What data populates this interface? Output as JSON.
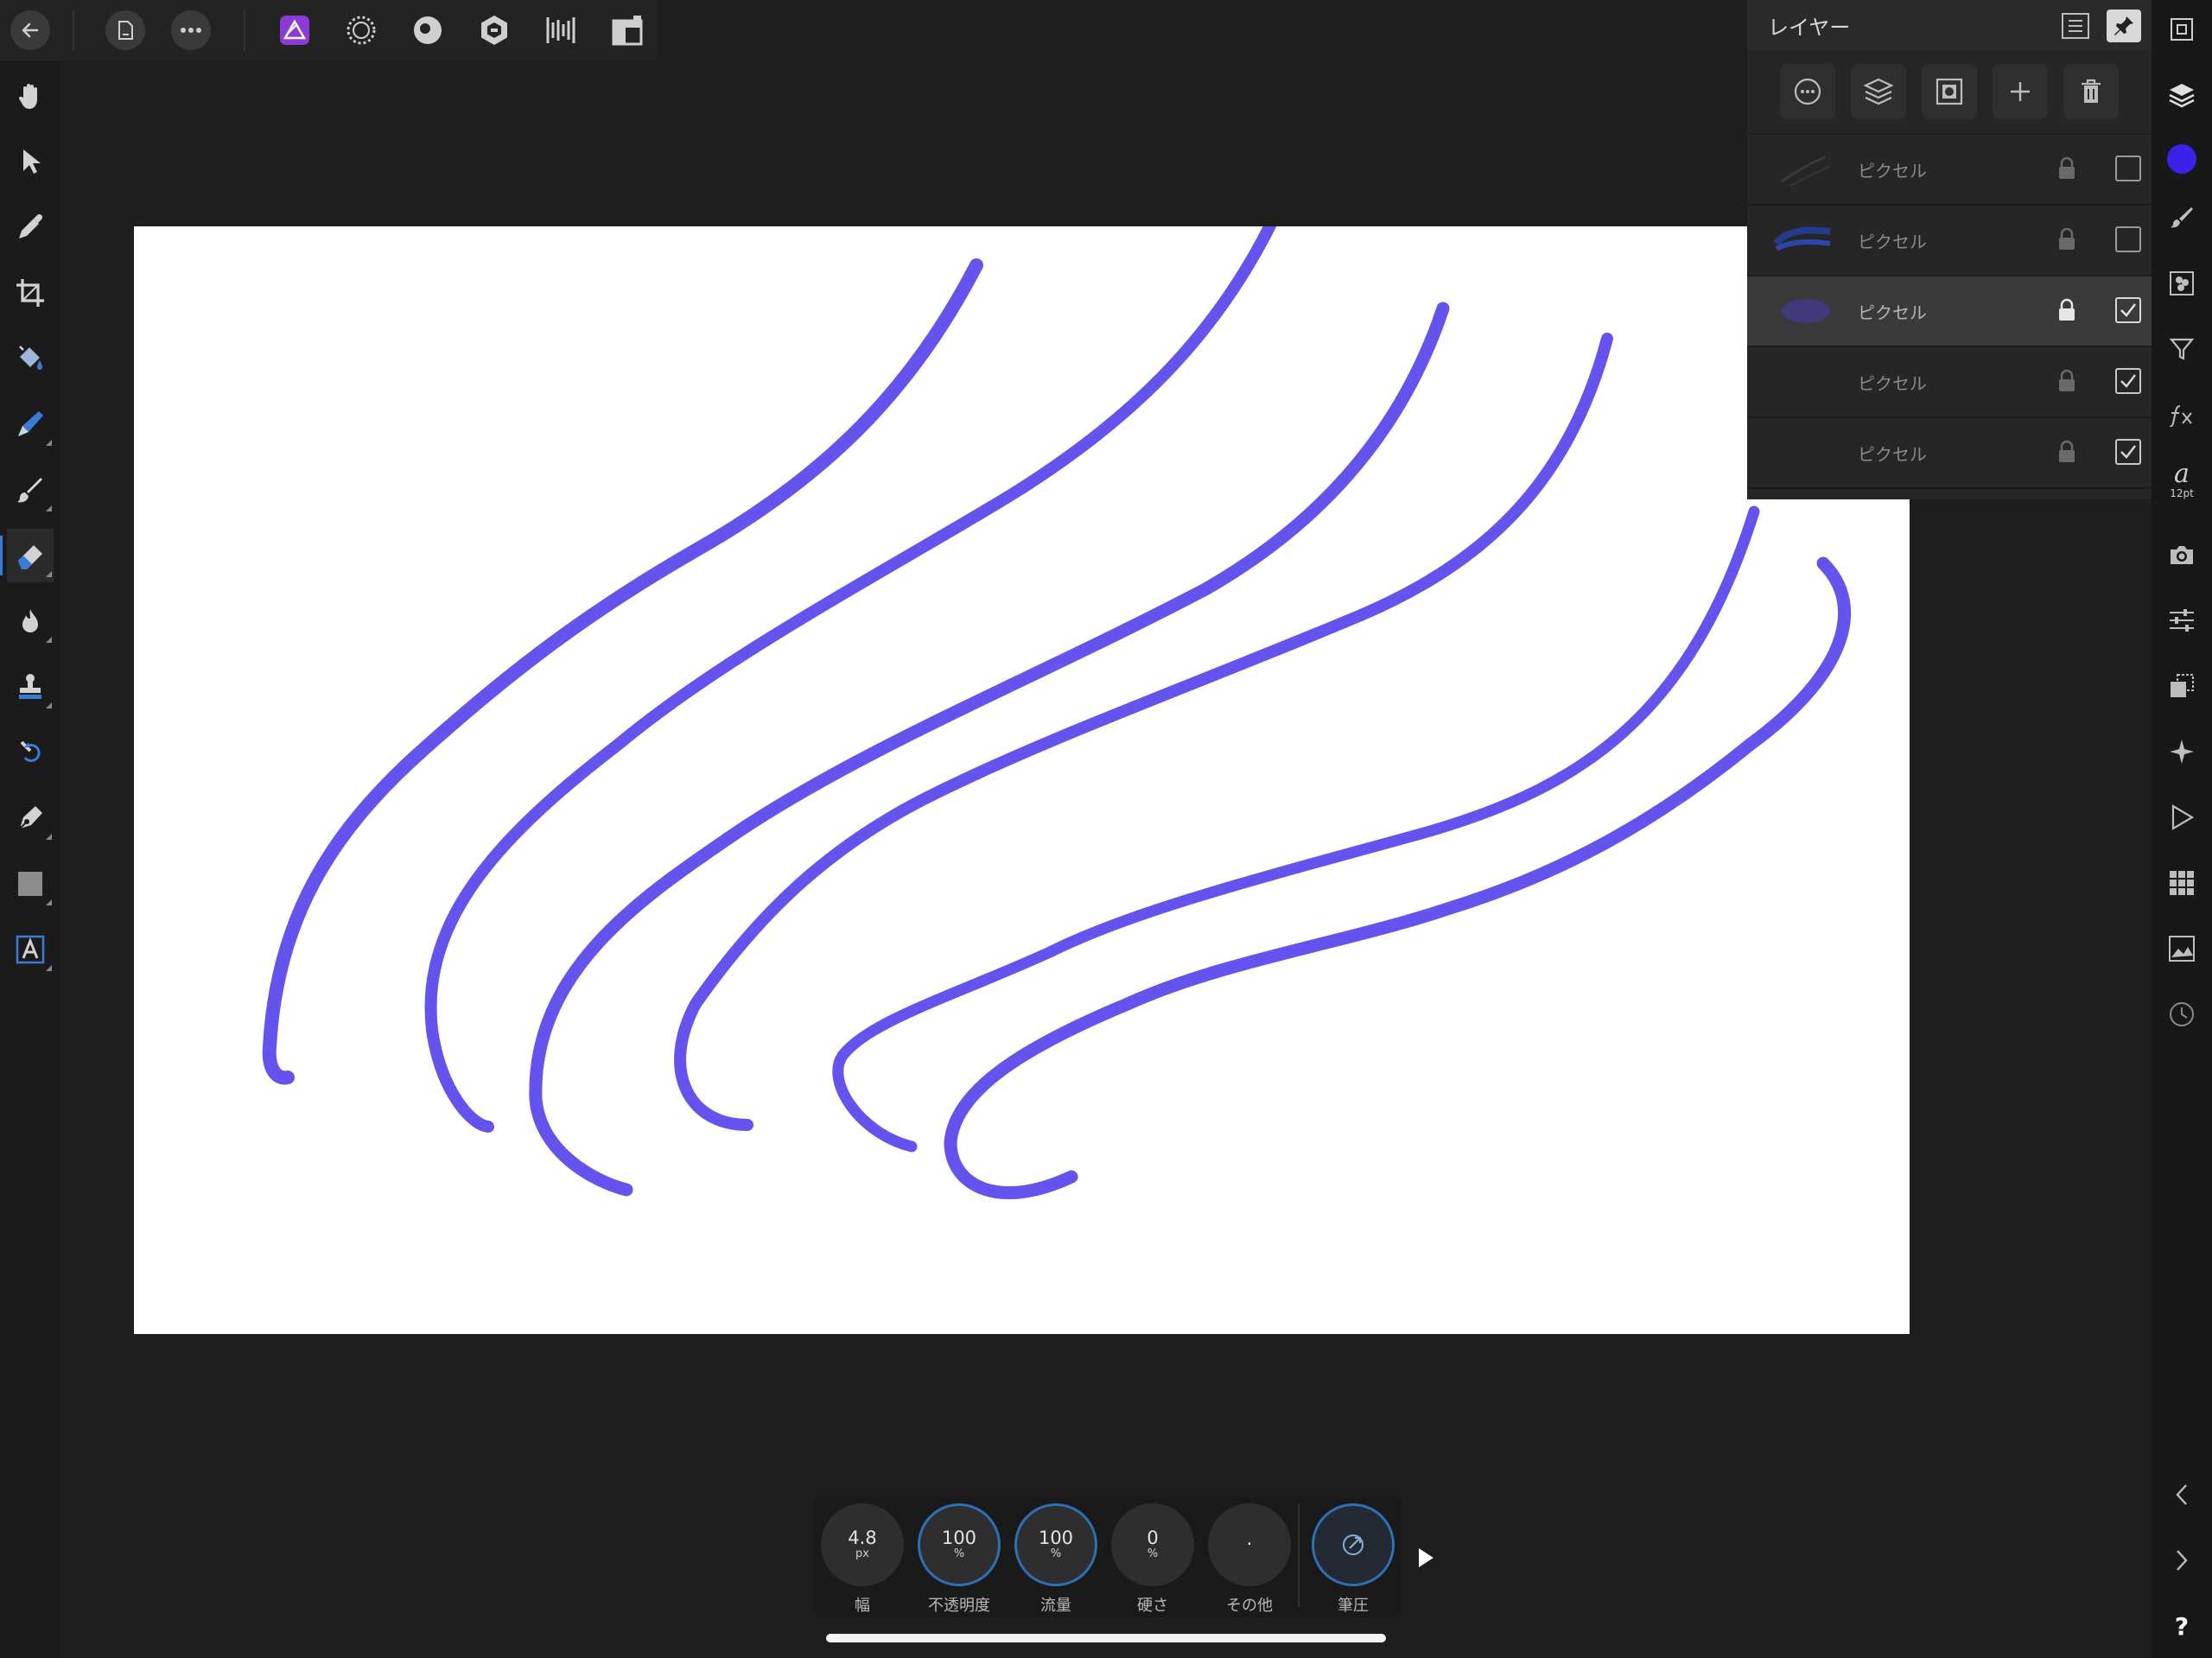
{
  "topbar": {
    "buttons": [
      {
        "name": "back-button",
        "icon": "arrow-left-icon"
      },
      {
        "name": "document-button",
        "icon": "document-icon"
      },
      {
        "name": "more-button",
        "icon": "ellipsis-icon"
      },
      {
        "name": "photo-persona-button",
        "icon": "photo-persona-icon",
        "active": true
      },
      {
        "name": "liquify-persona-button",
        "icon": "liquify-persona-icon"
      },
      {
        "name": "develop-persona-button",
        "icon": "develop-persona-icon"
      },
      {
        "name": "tone-mapping-persona-button",
        "icon": "tone-mapping-persona-icon"
      },
      {
        "name": "export-persona-button",
        "icon": "export-persona-icon"
      },
      {
        "name": "layout-button",
        "icon": "layout-icon"
      }
    ]
  },
  "tools": [
    "hand-icon",
    "move-icon",
    "color-picker-icon",
    "crop-icon",
    "flood-fill-icon",
    "selection-brush-icon",
    "paint-brush-icon",
    "erase-brush-icon",
    "dodge-brush-icon",
    "clone-brush-icon",
    "undo-brush-icon",
    "pen-icon",
    "rectangle-icon",
    "text-icon"
  ],
  "layers_panel": {
    "title": "レイヤー",
    "layers": [
      {
        "name": "ピクセル",
        "checked": false,
        "selected": false
      },
      {
        "name": "ピクセル",
        "checked": false,
        "selected": false
      },
      {
        "name": "ピクセル",
        "checked": true,
        "selected": true
      },
      {
        "name": "ピクセル",
        "checked": true,
        "selected": false
      },
      {
        "name": "ピクセル",
        "checked": true,
        "selected": false
      }
    ]
  },
  "right_strip": {
    "font_size_label": "12pt",
    "help_label": "?",
    "colors": {
      "primary": "#3b22e8"
    }
  },
  "context_toolbar": {
    "width": {
      "value": "4.8",
      "unit": "px",
      "label": "幅"
    },
    "opacity": {
      "value": "100",
      "unit": "%",
      "label": "不透明度"
    },
    "flow": {
      "value": "100",
      "unit": "%",
      "label": "流量"
    },
    "hardness": {
      "value": "0",
      "unit": "%",
      "label": "硬さ"
    },
    "more": {
      "value": "·",
      "label": "その他"
    },
    "pressure": {
      "label": "筆圧"
    }
  },
  "stroke_color": "#6553ee"
}
